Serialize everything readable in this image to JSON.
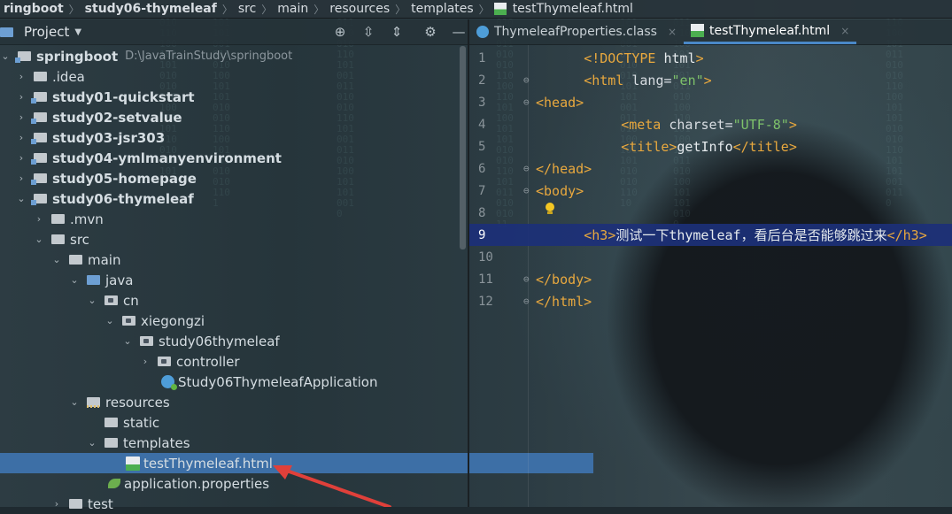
{
  "breadcrumb": [
    "ringboot",
    "study06-thymeleaf",
    "src",
    "main",
    "resources",
    "templates",
    "testThymeleaf.html"
  ],
  "project_panel": {
    "title": "Project",
    "icons": [
      "target-icon",
      "collapse-all-icon",
      "expand-all-icon",
      "gear-icon",
      "minimize-icon"
    ]
  },
  "tree": [
    {
      "label": "springboot",
      "path": "D:\\JavaTrainStudy\\springboot"
    },
    {
      "label": ".idea"
    },
    {
      "label": "study01-quickstart"
    },
    {
      "label": "study02-setvalue"
    },
    {
      "label": "study03-jsr303"
    },
    {
      "label": "study04-ymlmanyenvironment"
    },
    {
      "label": "study05-homepage"
    },
    {
      "label": "study06-thymeleaf"
    },
    {
      "label": ".mvn"
    },
    {
      "label": "src"
    },
    {
      "label": "main"
    },
    {
      "label": "java"
    },
    {
      "label": "cn"
    },
    {
      "label": "xiegongzi"
    },
    {
      "label": "study06thymeleaf"
    },
    {
      "label": "controller"
    },
    {
      "label": "Study06ThymeleafApplication"
    },
    {
      "label": "resources"
    },
    {
      "label": "static"
    },
    {
      "label": "templates"
    },
    {
      "label": "testThymeleaf.html"
    },
    {
      "label": "application.properties"
    },
    {
      "label": "test"
    }
  ],
  "tabs": [
    {
      "label": "ThymeleafProperties.class",
      "active": false
    },
    {
      "label": "testThymeleaf.html",
      "active": true
    }
  ],
  "editor": {
    "current_line": 9,
    "line_numbers": [
      "1",
      "2",
      "3",
      "4",
      "5",
      "6",
      "7",
      "8",
      "9",
      "10",
      "11",
      "12"
    ],
    "code": {
      "l1_tag": "<!DOCTYPE ",
      "l1_rest": "html",
      "l1_end": ">",
      "l2_open": "<html ",
      "l2_attr": "lang=",
      "l2_val": "\"en\"",
      "l2_end": ">",
      "l3": "<head>",
      "l4_open": "<meta ",
      "l4_attr": "charset=",
      "l4_val": "\"UTF-8\"",
      "l4_end": ">",
      "l5_open": "<title>",
      "l5_text": "getInfo",
      "l5_close": "</title>",
      "l6": "</head>",
      "l7": "<body>",
      "l9_open": "<h3>",
      "l9_text": "测试一下thymeleaf，看后台是否能够跳过来",
      "l9_close": "</h3>",
      "l11": "</body>",
      "l12": "</html>"
    }
  },
  "colors": {
    "tag": "#e8a83e",
    "string": "#7ec26a",
    "selection": "#3d6fa6",
    "current_line": "#1c3078",
    "annotation_arrow": "#e0403a"
  }
}
